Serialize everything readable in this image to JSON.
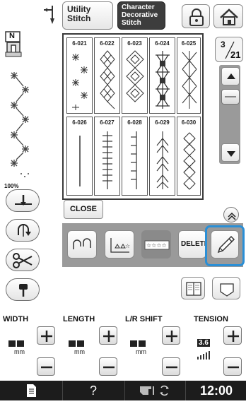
{
  "header": {
    "utility_label": "Utility\nStitch",
    "character_label": "Character\nDecorative\nStitch"
  },
  "left_panel": {
    "zoom": "100%",
    "presser_foot_letter": "N"
  },
  "page_indicator": {
    "current": "3",
    "total": "21"
  },
  "stitch_grid": [
    {
      "code": "6-021"
    },
    {
      "code": "6-022"
    },
    {
      "code": "6-023"
    },
    {
      "code": "6-024"
    },
    {
      "code": "6-025"
    },
    {
      "code": "6-026"
    },
    {
      "code": "6-027"
    },
    {
      "code": "6-028"
    },
    {
      "code": "6-029"
    },
    {
      "code": "6-030"
    }
  ],
  "actions": {
    "close_label": "CLOSE",
    "delete_label": "DELETE"
  },
  "settings": {
    "width_label": "WIDTH",
    "length_label": "LENGTH",
    "lr_shift_label": "L/R SHIFT",
    "tension_label": "TENSION",
    "unit": "mm",
    "tension_value": "3.6"
  },
  "status_bar": {
    "help_label": "?",
    "time": "12:00"
  },
  "colors": {
    "highlight": "#2a8fd6",
    "dark_button": "#3a3a3a",
    "status_bar": "#1c1c1c"
  },
  "icons": [
    "twin-needle-icon",
    "lock-icon",
    "home-icon",
    "presser-foot-icon",
    "scroll-up-icon",
    "scroll-down-icon",
    "needle-position-icon",
    "thread-cutter-icon",
    "scissors-icon",
    "needle-stop-icon",
    "edit-pencil-icon",
    "manual-icon",
    "pocket-icon",
    "document-icon",
    "machine-icon",
    "arrows-icon"
  ]
}
